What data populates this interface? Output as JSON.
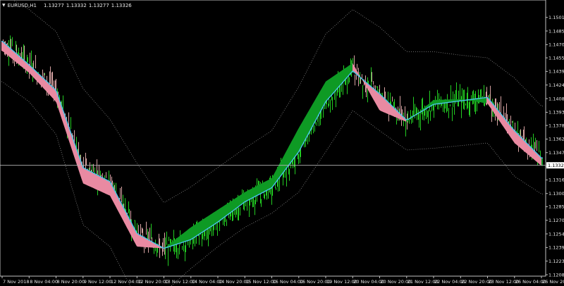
{
  "header": {
    "symbol": "EURUSD,H1",
    "prices": [
      "1.13277",
      "1.13332",
      "1.13277",
      "1.13326"
    ],
    "dropdown_icon": "triangle-down-icon"
  },
  "price_axis": {
    "labels": [
      "1.15010",
      "1.14855",
      "1.14700",
      "1.14550",
      "1.14395",
      "1.14240",
      "1.14085",
      "1.13930",
      "1.13780",
      "1.13625",
      "1.13470",
      "1.13316",
      "1.13160",
      "1.13005",
      "1.12855",
      "1.12700",
      "1.12545",
      "1.12390",
      "1.12235",
      "1.12080"
    ],
    "current_price": "1.13326"
  },
  "time_axis": {
    "labels": [
      "7 Nov 2018",
      "8 Nov 04:00",
      "8 Nov 20:00",
      "9 Nov 12:00",
      "12 Nov 04:00",
      "12 Nov 20:00",
      "13 Nov 12:00",
      "14 Nov 04:00",
      "14 Nov 20:00",
      "15 Nov 12:00",
      "16 Nov 04:00",
      "16 Nov 20:00",
      "19 Nov 12:00",
      "20 Nov 04:00",
      "20 Nov 20:00",
      "21 Nov 12:00",
      "22 Nov 04:00",
      "22 Nov 20:00",
      "23 Nov 12:00",
      "26 Nov 04:00",
      "26 Nov 20:00"
    ]
  },
  "colors": {
    "background": "#000000",
    "bull_bar": "#22cc22",
    "bear_bar": "#d6a2a2",
    "ribbon_up": "#0e9a24",
    "ribbon_down": "#e98aa2",
    "fast_ma": "#48c4e6",
    "envelope": "#888888",
    "axis_text": "#e6e6e6",
    "price_line": "#b8b8b8"
  },
  "chart_data": {
    "type": "line",
    "title": "",
    "xlabel": "",
    "ylabel": "",
    "ylim": [
      1.1208,
      1.1516
    ],
    "categories": [
      "7 Nov 2018",
      "8 Nov 04:00",
      "8 Nov 20:00",
      "9 Nov 12:00",
      "12 Nov 04:00",
      "12 Nov 20:00",
      "13 Nov 12:00",
      "14 Nov 04:00",
      "14 Nov 20:00",
      "15 Nov 12:00",
      "16 Nov 04:00",
      "16 Nov 20:00",
      "19 Nov 12:00",
      "20 Nov 04:00",
      "20 Nov 20:00",
      "21 Nov 12:00",
      "22 Nov 04:00",
      "22 Nov 20:00",
      "23 Nov 12:00",
      "26 Nov 04:00",
      "26 Nov 20:00"
    ],
    "series": [
      {
        "values": [
          1.1463,
          1.1438,
          1.1405,
          1.1312,
          1.1298,
          1.124,
          1.1238,
          1.1262,
          1.1282,
          1.1302,
          1.1318,
          1.1375,
          1.1428,
          1.1449,
          1.1395,
          1.1382,
          1.1407,
          1.1408,
          1.1403,
          1.1358,
          1.1332
        ]
      },
      {
        "values": [
          1.1474,
          1.1447,
          1.1418,
          1.133,
          1.1314,
          1.1255,
          1.1238,
          1.1248,
          1.1268,
          1.1291,
          1.1307,
          1.1348,
          1.1405,
          1.144,
          1.1414,
          1.1384,
          1.1402,
          1.1406,
          1.141,
          1.1372,
          1.1341
        ]
      },
      {
        "values": [
          1.1528,
          1.151,
          1.1485,
          1.142,
          1.1385,
          1.1335,
          1.129,
          1.1308,
          1.133,
          1.1352,
          1.1372,
          1.1422,
          1.1482,
          1.151,
          1.149,
          1.1462,
          1.1462,
          1.1458,
          1.1455,
          1.1432,
          1.14
        ]
      },
      {
        "values": [
          1.1428,
          1.1405,
          1.1368,
          1.1265,
          1.124,
          1.118,
          1.1188,
          1.1215,
          1.124,
          1.1262,
          1.1278,
          1.1302,
          1.1348,
          1.1395,
          1.1372,
          1.135,
          1.1352,
          1.1355,
          1.1358,
          1.132,
          1.13
        ]
      }
    ],
    "current_price": 1.13326,
    "grid": false,
    "legend": "none"
  }
}
